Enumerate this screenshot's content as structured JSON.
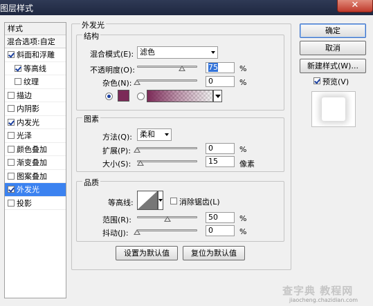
{
  "window": {
    "title": "图层样式",
    "close_label": "✕"
  },
  "sidebar": {
    "header": "样式",
    "blend_options": "混合选项:自定",
    "items": [
      {
        "label": "斜面和浮雕",
        "checked": true,
        "indent": false,
        "selected": false
      },
      {
        "label": "等高线",
        "checked": true,
        "indent": true,
        "selected": false
      },
      {
        "label": "纹理",
        "checked": false,
        "indent": true,
        "selected": false
      },
      {
        "label": "描边",
        "checked": false,
        "indent": false,
        "selected": false
      },
      {
        "label": "内阴影",
        "checked": false,
        "indent": false,
        "selected": false
      },
      {
        "label": "内发光",
        "checked": true,
        "indent": false,
        "selected": false
      },
      {
        "label": "光泽",
        "checked": false,
        "indent": false,
        "selected": false
      },
      {
        "label": "颜色叠加",
        "checked": false,
        "indent": false,
        "selected": false
      },
      {
        "label": "渐变叠加",
        "checked": false,
        "indent": false,
        "selected": false
      },
      {
        "label": "图案叠加",
        "checked": false,
        "indent": false,
        "selected": false
      },
      {
        "label": "外发光",
        "checked": true,
        "indent": false,
        "selected": true
      },
      {
        "label": "投影",
        "checked": false,
        "indent": false,
        "selected": false
      }
    ]
  },
  "panel": {
    "title": "外发光",
    "structure": {
      "legend": "结构",
      "blend_mode_label": "混合模式(E):",
      "blend_mode_value": "滤色",
      "opacity_label": "不透明度(O):",
      "opacity_value": "75",
      "opacity_unit": "%",
      "noise_label": "杂色(N):",
      "noise_value": "0",
      "noise_unit": "%",
      "color_swatch": "#7b2a57"
    },
    "elements": {
      "legend": "图素",
      "technique_label": "方法(Q):",
      "technique_value": "柔和",
      "spread_label": "扩展(P):",
      "spread_value": "0",
      "spread_unit": "%",
      "size_label": "大小(S):",
      "size_value": "15",
      "size_unit": "像素"
    },
    "quality": {
      "legend": "品质",
      "contour_label": "等高线:",
      "antialias_label": "消除锯齿(L)",
      "range_label": "范围(R):",
      "range_value": "50",
      "range_unit": "%",
      "jitter_label": "抖动(J):",
      "jitter_value": "0",
      "jitter_unit": "%"
    },
    "make_default": "设置为默认值",
    "reset_default": "复位为默认值"
  },
  "actions": {
    "ok": "确定",
    "cancel": "取消",
    "new_style": "新建样式(W)...",
    "preview_label": "预览(V)"
  },
  "watermark": {
    "main": "查字典 教程网",
    "sub": "jiaocheng.chazidian.com"
  }
}
